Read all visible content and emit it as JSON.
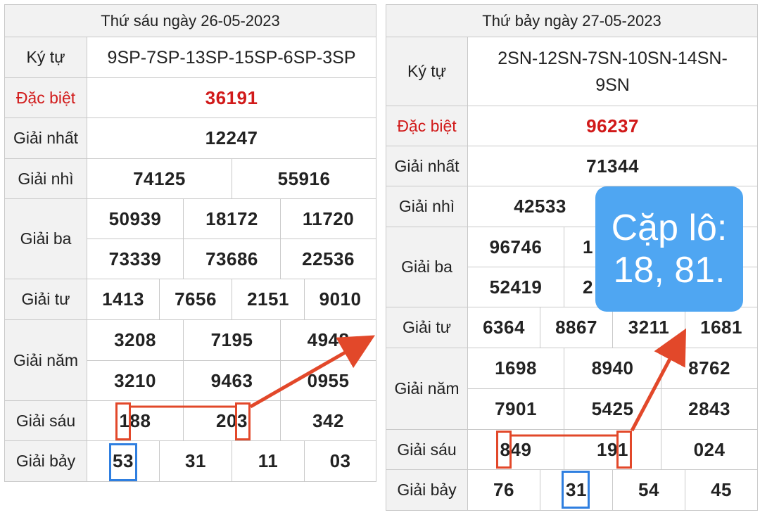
{
  "left": {
    "title": "Thứ sáu ngày 26-05-2023",
    "labels": {
      "kytu": "Ký tự",
      "db": "Đặc biệt",
      "g1": "Giải nhất",
      "g2": "Giải nhì",
      "g3": "Giải ba",
      "g4": "Giải tư",
      "g5": "Giải năm",
      "g6": "Giải sáu",
      "g7": "Giải bảy"
    },
    "kytu": "9SP-7SP-13SP-15SP-6SP-3SP",
    "db": "36191",
    "g1": "12247",
    "g2": [
      "74125",
      "55916"
    ],
    "g3": [
      "50939",
      "18172",
      "11720",
      "73339",
      "73686",
      "22536"
    ],
    "g4": [
      "1413",
      "7656",
      "2151",
      "9010"
    ],
    "g5": [
      "3208",
      "7195",
      "4948",
      "3210",
      "9463",
      "0955"
    ],
    "g6": [
      "188",
      "203",
      "342"
    ],
    "g7": [
      "53",
      "31",
      "11",
      "03"
    ]
  },
  "right": {
    "title": "Thứ bảy ngày 27-05-2023",
    "labels": {
      "kytu": "Ký tự",
      "db": "Đặc biệt",
      "g1": "Giải nhất",
      "g2": "Giải nhì",
      "g3": "Giải ba",
      "g4": "Giải tư",
      "g5": "Giải năm",
      "g6": "Giải sáu",
      "g7": "Giải bảy"
    },
    "kytu": "2SN-12SN-7SN-10SN-14SN-9SN",
    "db": "96237",
    "g1": "71344",
    "g2": [
      "42533",
      ""
    ],
    "g3": [
      "96746",
      "1",
      "",
      "52419",
      "2",
      ""
    ],
    "g4": [
      "6364",
      "8867",
      "3211",
      "1681"
    ],
    "g5": [
      "1698",
      "8940",
      "8762",
      "7901",
      "5425",
      "2843"
    ],
    "g6": [
      "849",
      "191",
      "024"
    ],
    "g7": [
      "76",
      "31",
      "54",
      "45"
    ]
  },
  "note": {
    "line1": "Cặp lô:",
    "line2": "18, 81."
  },
  "colors": {
    "special": "#d11a1a",
    "annotation": "#e2482a",
    "highlight_blue": "#2f7fe0",
    "note_bg": "#4fa6f2"
  }
}
